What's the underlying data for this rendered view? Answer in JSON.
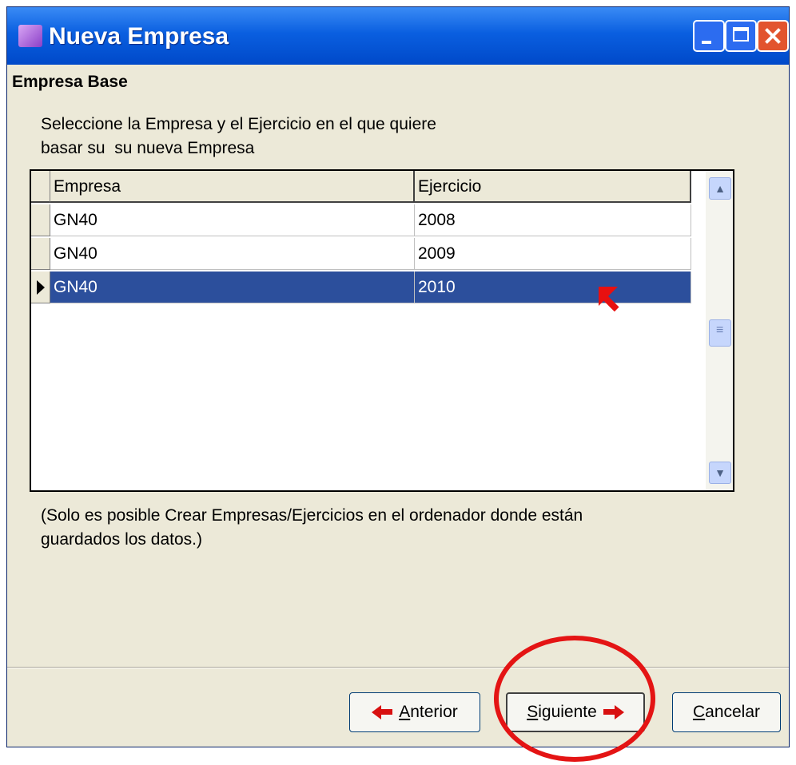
{
  "window": {
    "title": "Nueva Empresa"
  },
  "section_title": "Empresa Base",
  "instructions": {
    "line1": "Seleccione la Empresa y el Ejercicio en el que quiere",
    "line2": "basar su  su nueva Empresa"
  },
  "grid": {
    "headers": [
      "Empresa",
      "Ejercicio"
    ],
    "rows": [
      {
        "empresa": "GN40",
        "ejercicio": "2008"
      },
      {
        "empresa": "GN40",
        "ejercicio": "2009"
      },
      {
        "empresa": "GN40",
        "ejercicio": "2010"
      }
    ],
    "selected_row": 2
  },
  "note": {
    "line1": "(Solo es posible Crear Empresas/Ejercicios en el ordenador donde están",
    "line2": "guardados los datos.)"
  },
  "buttons": {
    "anterior": {
      "underline": "A",
      "rest": "nterior"
    },
    "siguiente": {
      "underline": "S",
      "rest": "iguiente"
    },
    "cancelar": {
      "underline": "C",
      "rest": "ancelar"
    }
  },
  "colors": {
    "selection": "#2c4f9c",
    "highlight_circle": "#e41414",
    "arrow": "#d81010"
  }
}
